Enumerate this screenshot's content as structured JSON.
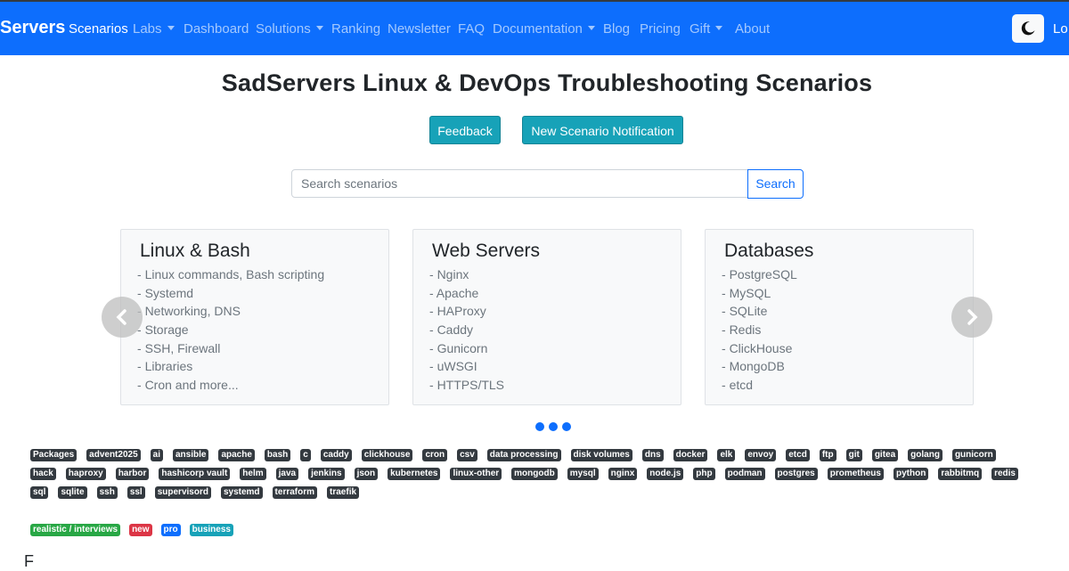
{
  "navbar": {
    "brand": "Servers",
    "items": [
      {
        "label": "Scenarios",
        "active": true,
        "dropdown": false
      },
      {
        "label": "Labs",
        "active": false,
        "dropdown": true
      },
      {
        "label": "Dashboard",
        "active": false,
        "dropdown": false
      },
      {
        "label": "Solutions",
        "active": false,
        "dropdown": true
      },
      {
        "label": "Ranking",
        "active": false,
        "dropdown": false
      },
      {
        "label": "Newsletter",
        "active": false,
        "dropdown": false
      },
      {
        "label": "FAQ",
        "active": false,
        "dropdown": false
      },
      {
        "label": "Documentation",
        "active": false,
        "dropdown": true
      },
      {
        "label": "Blog",
        "active": false,
        "dropdown": false
      },
      {
        "label": "Pricing",
        "active": false,
        "dropdown": false
      },
      {
        "label": "Gift",
        "active": false,
        "dropdown": true
      },
      {
        "label": "About",
        "active": false,
        "dropdown": false
      }
    ],
    "theme_toggle_icon": "moon-icon",
    "login_label": "Lo"
  },
  "page": {
    "title": "SadServers Linux & DevOps Troubleshooting Scenarios",
    "feedback_label": "Feedback",
    "notify_label": "New Scenario Notification",
    "search": {
      "placeholder": "Search scenarios",
      "value": "",
      "button_label": "Search"
    }
  },
  "carousel": {
    "cards": [
      {
        "title": "Linux & Bash",
        "items": [
          "Linux commands, Bash scripting",
          "Systemd",
          "Networking, DNS",
          "Storage",
          "SSH, Firewall",
          "Libraries",
          "Cron and more..."
        ]
      },
      {
        "title": "Web Servers",
        "items": [
          "Nginx",
          "Apache",
          "HAProxy",
          "Caddy",
          "Gunicorn",
          "uWSGI",
          "HTTPS/TLS"
        ]
      },
      {
        "title": "Databases",
        "items": [
          "PostgreSQL",
          "MySQL",
          "SQLite",
          "Redis",
          "ClickHouse",
          "MongoDB",
          "etcd"
        ]
      }
    ],
    "prev_icon": "chevron-left-icon",
    "next_icon": "chevron-right-icon",
    "indicator_count": 3
  },
  "tags": {
    "rows": [
      [
        "Packages",
        "advent2025",
        "ai",
        "ansible",
        "apache",
        "bash",
        "c",
        "caddy",
        "clickhouse",
        "cron",
        "csv",
        "data processing",
        "disk volumes",
        "dns",
        "docker",
        "elk",
        "envoy",
        "etcd",
        "ftp",
        "git",
        "gitea",
        "golang",
        "gunicorn"
      ],
      [
        "hack",
        "haproxy",
        "harbor",
        "hashicorp vault",
        "helm",
        "java",
        "jenkins",
        "json",
        "kubernetes",
        "linux-other",
        "mongodb",
        "mysql",
        "nginx",
        "node.js",
        "php",
        "podman",
        "postgres",
        "prometheus",
        "python",
        "rabbitmq",
        "redis"
      ],
      [
        "sql",
        "sqlite",
        "ssh",
        "ssl",
        "supervisord",
        "systemd",
        "terraform",
        "traefik"
      ]
    ],
    "category_badges": [
      {
        "label": "realistic / interviews",
        "color": "#28a745"
      },
      {
        "label": "new",
        "color": "#dc3545"
      },
      {
        "label": "pro",
        "color": "#0d6efd"
      },
      {
        "label": "business",
        "color": "#17a2b8"
      }
    ]
  },
  "footer_partial_text": "F",
  "colors": {
    "navbar": "#0d6efd",
    "teal_button": "#17a2b8",
    "tag_dark": "#343a40"
  }
}
